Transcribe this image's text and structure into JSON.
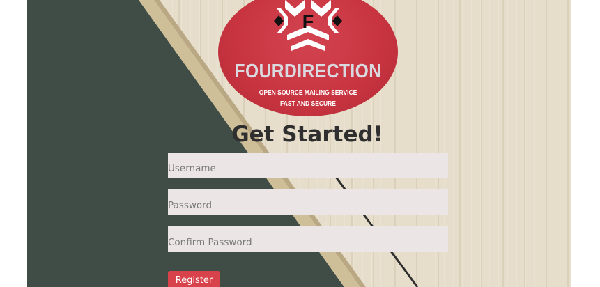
{
  "logo": {
    "letter": "F",
    "title": "FOURDIRECTION",
    "subtitle_line1": "OPEN SOURCE MAILING SERVICE",
    "subtitle_line2": "FAST AND SECURE"
  },
  "form": {
    "heading": "Get Started!",
    "username_placeholder": "Username",
    "password_placeholder": "Password",
    "confirm_placeholder": "Confirm Password",
    "register_label": "Register"
  },
  "colors": {
    "logo_red": "#c73440",
    "button_red": "#d8424a",
    "field_bg": "#ece5e6",
    "board_green": "#3f4d46"
  }
}
